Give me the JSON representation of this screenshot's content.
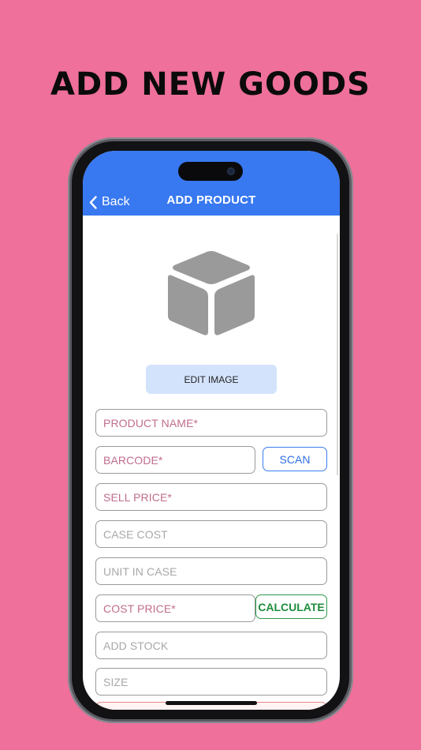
{
  "headline": "ADD NEW GOODS",
  "navbar": {
    "back_label": "Back",
    "title": "ADD PRODUCT",
    "color": "#3878f0"
  },
  "image_section": {
    "icon": "cube-icon",
    "edit_button_label": "EDIT IMAGE"
  },
  "form": {
    "product_name_placeholder": "PRODUCT NAME*",
    "barcode_placeholder": "BARCODE*",
    "scan_label": "SCAN",
    "sell_price_placeholder": "SELL PRICE*",
    "case_cost_placeholder": "CASE COST",
    "unit_in_case_placeholder": "UNIT IN CASE",
    "cost_price_placeholder": "COST PRICE*",
    "calculate_label": "CALCULATE",
    "add_stock_placeholder": "ADD STOCK",
    "size_placeholder": "SIZE"
  },
  "colors": {
    "background": "#ef709a",
    "required_placeholder": "#c16d8e",
    "scan": "#2f6fe6",
    "calculate": "#1f8c3c"
  }
}
